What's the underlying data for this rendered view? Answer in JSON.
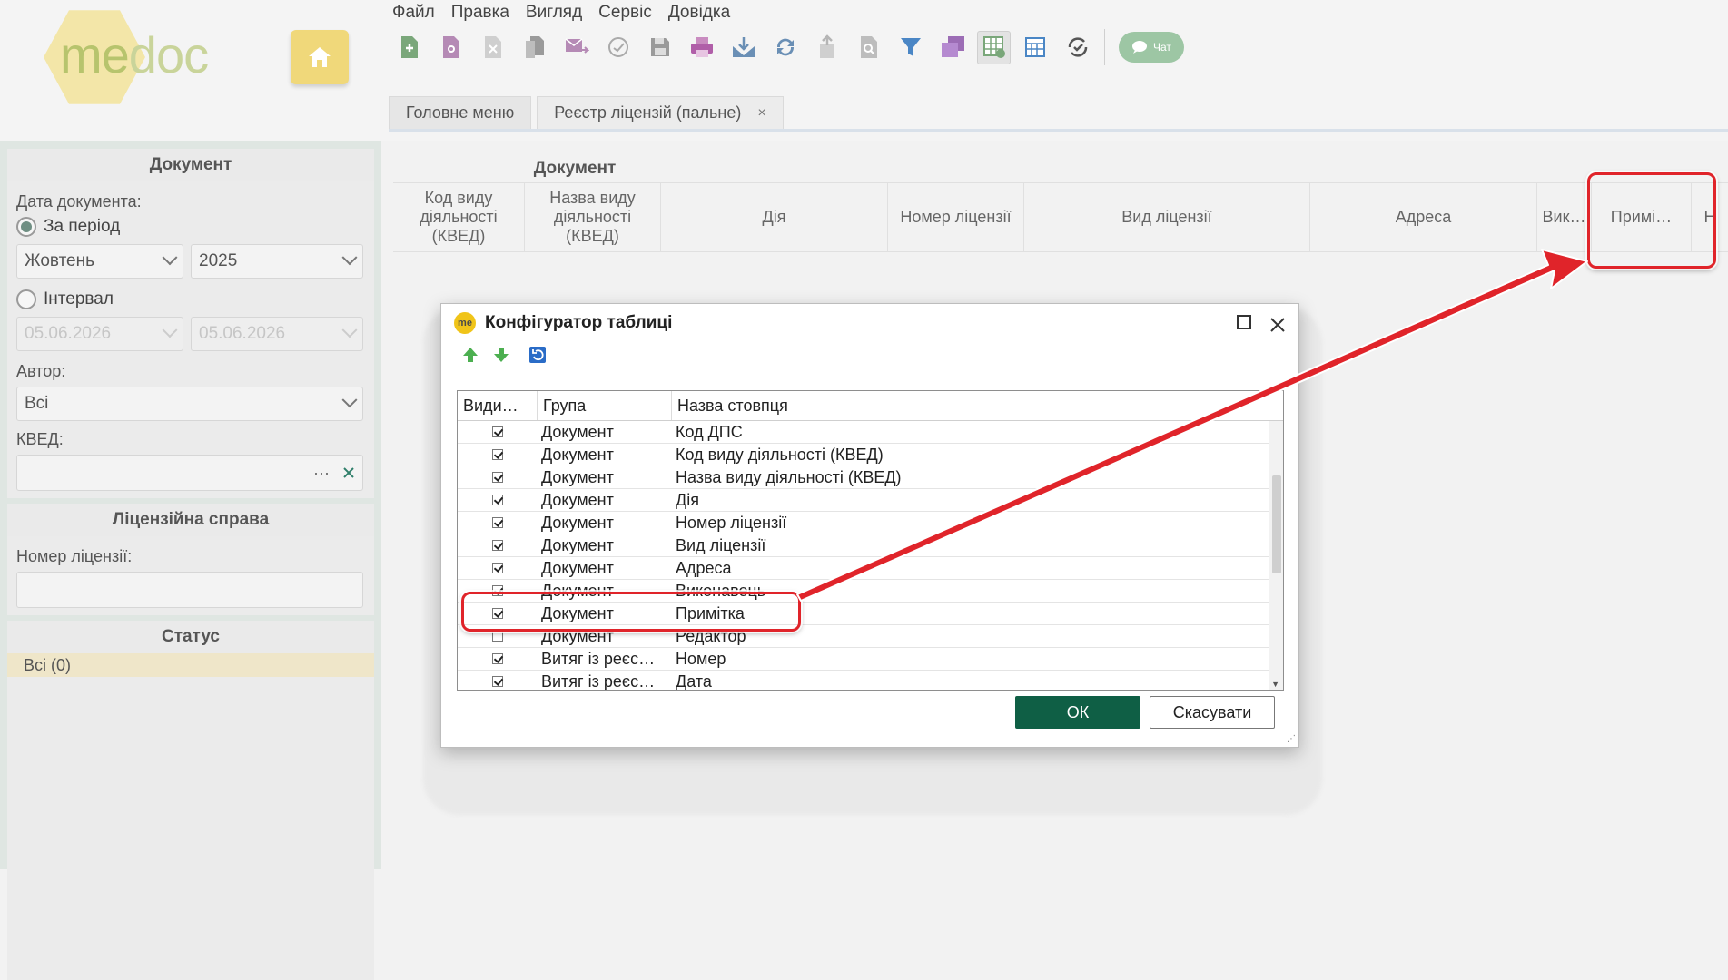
{
  "app": {
    "logo_me": "me",
    "logo_doc": "doc",
    "menu": [
      "Файл",
      "Правка",
      "Вигляд",
      "Сервіс",
      "Довідка"
    ],
    "toolbar_icons": [
      "add-icon",
      "view-icon",
      "delete-icon",
      "copy-icon",
      "send-icon",
      "sign-icon",
      "save-icon",
      "print-icon",
      "download-icon",
      "sync-icon",
      "upload-icon",
      "preview-icon",
      "filter-icon",
      "layers-icon",
      "table-config-icon",
      "calendar-icon",
      "refresh-check-icon"
    ],
    "chat_label": "Чат",
    "tabs": [
      {
        "label": "Головне меню"
      },
      {
        "label": "Реєстр ліцензій (пальне)",
        "close": "×"
      }
    ]
  },
  "left_panel": {
    "document_title": "Документ",
    "date_label": "Дата документа:",
    "period_label": "За період",
    "month_value": "Жовтень",
    "year_value": "2025",
    "interval_label": "Інтервал",
    "interval_from": "05.06.2026",
    "interval_to": "05.06.2026",
    "author_label": "Автор:",
    "author_value": "Всі",
    "kved_label": "КВЕД:",
    "kved_dots": "···",
    "license_case_title": "Ліцензійна справа",
    "license_number_label": "Номер ліцензії:",
    "status_title": "Статус",
    "status_item": "Всі (0)"
  },
  "grid": {
    "group_header": "Документ",
    "columns": [
      "Код виду діяльності (КВЕД)",
      "Назва виду діяльності (КВЕД)",
      "Дія",
      "Номер ліцензії",
      "Вид ліцензії",
      "Адреса",
      "Вик…",
      "Примі…",
      "Н"
    ]
  },
  "dialog": {
    "title": "Конфігуратор таблиці",
    "logo": "me",
    "headers": {
      "visible": "Види…",
      "group": "Група",
      "column_name": "Назва стовпця"
    },
    "rows": [
      {
        "checked": true,
        "group": "Документ",
        "name": "Код ДПС"
      },
      {
        "checked": true,
        "group": "Документ",
        "name": "Код виду діяльності (КВЕД)"
      },
      {
        "checked": true,
        "group": "Документ",
        "name": "Назва виду діяльності (КВЕД)"
      },
      {
        "checked": true,
        "group": "Документ",
        "name": "Дія"
      },
      {
        "checked": true,
        "group": "Документ",
        "name": "Номер ліцензії"
      },
      {
        "checked": true,
        "group": "Документ",
        "name": "Вид ліцензії"
      },
      {
        "checked": true,
        "group": "Документ",
        "name": "Адреса"
      },
      {
        "checked": true,
        "group": "Документ",
        "name": "Виконавець"
      },
      {
        "checked": true,
        "group": "Документ",
        "name": "Примітка"
      },
      {
        "checked": false,
        "group": "Документ",
        "name": "Редактор"
      },
      {
        "checked": true,
        "group": "Витяг із реєс…",
        "name": "Номер"
      },
      {
        "checked": true,
        "group": "Витяг із реєс…",
        "name": "Дата"
      }
    ],
    "ok_label": "ОК",
    "cancel_label": "Скасувати"
  },
  "colors": {
    "accent_green": "#0f5f45",
    "highlight_red": "#e0242a",
    "logo_yellow": "#f0c419"
  }
}
